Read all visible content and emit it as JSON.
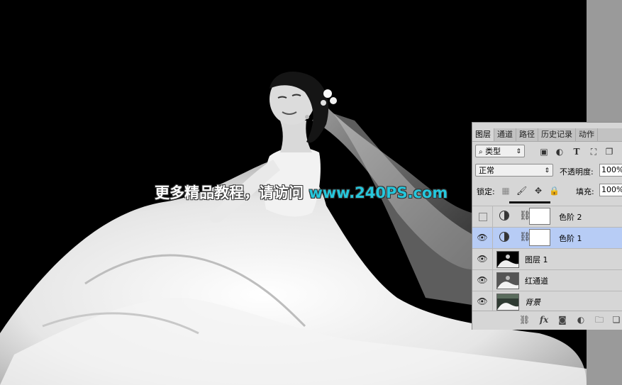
{
  "watermark": {
    "cn_text": "更多精品教程，请访问",
    "url_text": "www.240PS.com"
  },
  "layers_panel": {
    "tabs": [
      {
        "label": "图层",
        "active": true
      },
      {
        "label": "通道",
        "active": false
      },
      {
        "label": "路径",
        "active": false
      },
      {
        "label": "历史记录",
        "active": false
      },
      {
        "label": "动作",
        "active": false
      }
    ],
    "filter": {
      "value": "类型",
      "search_icon": "search-icon"
    },
    "blend_mode": "正常",
    "opacity_label": "不透明度:",
    "opacity_value": "100%",
    "lock_label": "锁定:",
    "fill_label": "填充:",
    "fill_value": "100%",
    "layers": [
      {
        "name": "色阶 2",
        "type": "adjustment",
        "visible": false,
        "selected": false
      },
      {
        "name": "色阶 1",
        "type": "adjustment",
        "visible": true,
        "selected": true
      },
      {
        "name": "图层 1",
        "type": "pixel",
        "visible": true,
        "selected": false
      },
      {
        "name": "红通道",
        "type": "pixel",
        "visible": true,
        "selected": false
      },
      {
        "name": "背景",
        "type": "background",
        "visible": true,
        "selected": false
      }
    ],
    "bottom_fx": "fx"
  },
  "colors": {
    "accent_url": "#25c7dc",
    "selected_layer": "#b7ccf5",
    "panel_bg": "#d6d6d6"
  }
}
